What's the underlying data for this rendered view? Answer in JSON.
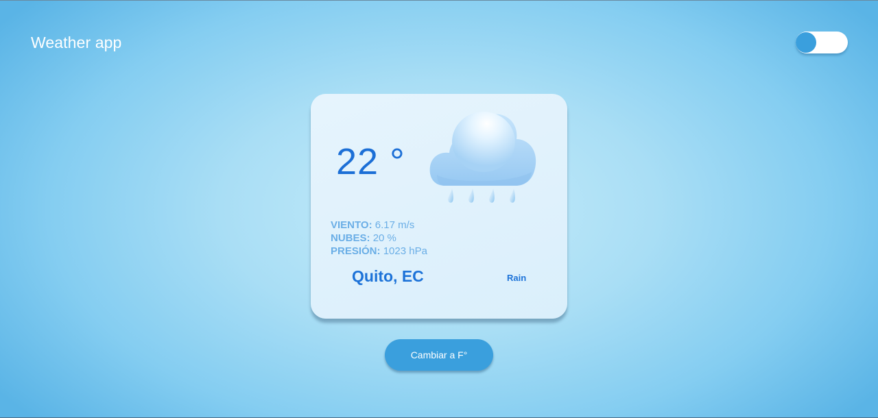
{
  "header": {
    "title": "Weather app",
    "theme_toggle": {
      "icon": "toggle-switch-icon",
      "state": "off"
    }
  },
  "card": {
    "temperature": "22 °",
    "icon": "rain-cloud-icon",
    "details": [
      {
        "label": "VIENTO:",
        "value": "6.17 m/s"
      },
      {
        "label": "NUBES:",
        "value": "20 %"
      },
      {
        "label": "PRESIÓN:",
        "value": "1023 hPa"
      }
    ],
    "city": "Quito, EC",
    "description": "Rain"
  },
  "convert_button": {
    "label": "Cambiar a F°"
  },
  "colors": {
    "accent": "#3a9fdd",
    "temperature_text": "#1c6fd6",
    "detail_text": "#6aaee6",
    "card_background": "#e2f2fc"
  }
}
